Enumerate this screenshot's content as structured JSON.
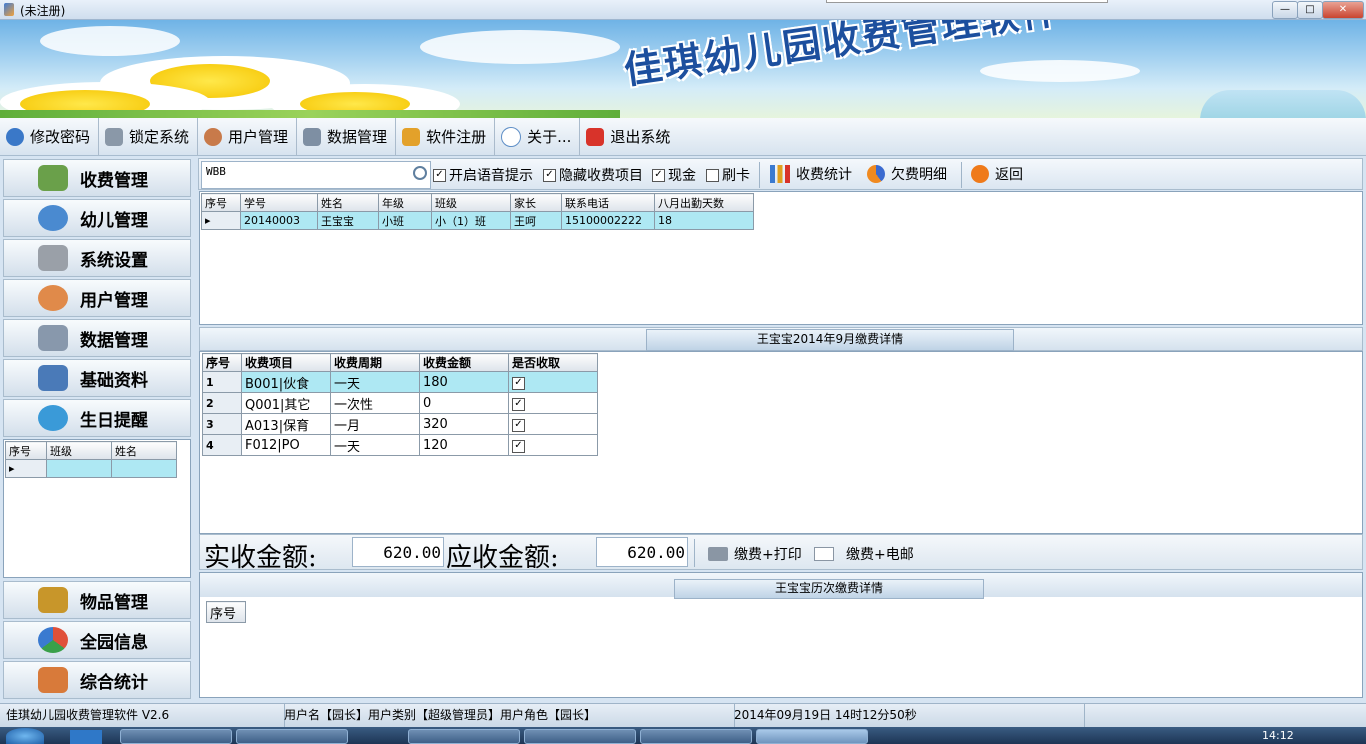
{
  "window": {
    "title": "(未注册)",
    "min_symbol": "—",
    "max_symbol": "□",
    "close_symbol": "✕"
  },
  "banner": {
    "title": "佳琪幼儿园收费管理软件"
  },
  "main_menu": [
    {
      "label": "修改密码",
      "icon": "magnifier-key-icon",
      "color": "#3a78c8"
    },
    {
      "label": "锁定系统",
      "icon": "lock-icon",
      "color": "#8a98a8"
    },
    {
      "label": "用户管理",
      "icon": "users-icon",
      "color": "#c87a4a"
    },
    {
      "label": "数据管理",
      "icon": "database-icon",
      "color": "#7e8fa3"
    },
    {
      "label": "软件注册",
      "icon": "house-icon",
      "color": "#e3a12a"
    },
    {
      "label": "关于...",
      "icon": "help-icon",
      "color": "#5f8fc7"
    },
    {
      "label": "退出系统",
      "icon": "exit-icon",
      "color": "#d8332a"
    }
  ],
  "nav_top": [
    {
      "label": "收费管理",
      "icon": "money-icon",
      "color": "#6aa04a"
    },
    {
      "label": "幼儿管理",
      "icon": "children-icon",
      "color": "#4a8ad0"
    },
    {
      "label": "系统设置",
      "icon": "tools-icon",
      "color": "#9aa0a8"
    },
    {
      "label": "用户管理",
      "icon": "user-icon",
      "color": "#e08a4a"
    },
    {
      "label": "数据管理",
      "icon": "database-icon",
      "color": "#8898ac"
    },
    {
      "label": "基础资料",
      "icon": "clipboard-icon",
      "color": "#4a7ab8"
    },
    {
      "label": "生日提醒",
      "icon": "clock-icon",
      "color": "#3a9ad8"
    }
  ],
  "nav_bottom": [
    {
      "label": "物品管理",
      "icon": "briefcase-icon",
      "color": "#c8962a"
    },
    {
      "label": "全园信息",
      "icon": "pie-icon",
      "color": "#e0503a"
    },
    {
      "label": "综合统计",
      "icon": "chart-icon",
      "color": "#d87a3a"
    }
  ],
  "birthday_grid": {
    "headers": [
      "序号",
      "班级",
      "姓名"
    ]
  },
  "toolbar": {
    "search_value": "WBB",
    "search_icon": "search-icon",
    "chk_voice": "开启语音提示",
    "chk_hide": "隐藏收费项目",
    "chk_cash": "现金",
    "chk_card": "刷卡",
    "check_mark": "✓",
    "stats": "收费统计",
    "arrears": "欠费明细",
    "back": "返回"
  },
  "student_grid": {
    "headers": [
      "序号",
      "学号",
      "姓名",
      "年级",
      "班级",
      "家长",
      "联系电话",
      "八月出勤天数"
    ],
    "rows": [
      {
        "no": "",
        "id": "20140003",
        "name": "王宝宝",
        "grade": "小班",
        "class": "小（1）班",
        "parent": "王呵",
        "phone": "15100002222",
        "days": "18"
      }
    ]
  },
  "fee_detail": {
    "caption": "王宝宝2014年9月缴费详情",
    "headers": [
      "序号",
      "收费项目",
      "收费周期",
      "收费金额",
      "是否收取"
    ],
    "rows": [
      {
        "no": "1",
        "item": "B001|伙食",
        "period": "一天",
        "amount": "180",
        "check": "✓"
      },
      {
        "no": "2",
        "item": "Q001|其它",
        "period": "一次性",
        "amount": "0",
        "check": "✓"
      },
      {
        "no": "3",
        "item": "A013|保育",
        "period": "一月",
        "amount": "320",
        "check": "✓"
      },
      {
        "no": "4",
        "item": "F012|PO",
        "period": "一天",
        "amount": "120",
        "check": "✓"
      }
    ]
  },
  "totals": {
    "actual_label": "实收金额:",
    "actual_value": "620.00",
    "due_label": "应收金额:",
    "due_value": "620.00",
    "pay_print": "缴费+打印",
    "pay_email": "缴费+电邮"
  },
  "history": {
    "caption": "王宝宝历次缴费详情",
    "headers": [
      "序号"
    ]
  },
  "statusbar": {
    "app": "佳琪幼儿园收费管理软件 V2.6",
    "user": "用户名【园长】用户类别【超级管理员】用户角色【园长】",
    "time": "2014年09月19日 14时12分50秒"
  },
  "taskbar": {
    "clock": "14:12",
    "tasks": [
      "",
      "",
      "",
      "",
      "",
      ""
    ]
  }
}
